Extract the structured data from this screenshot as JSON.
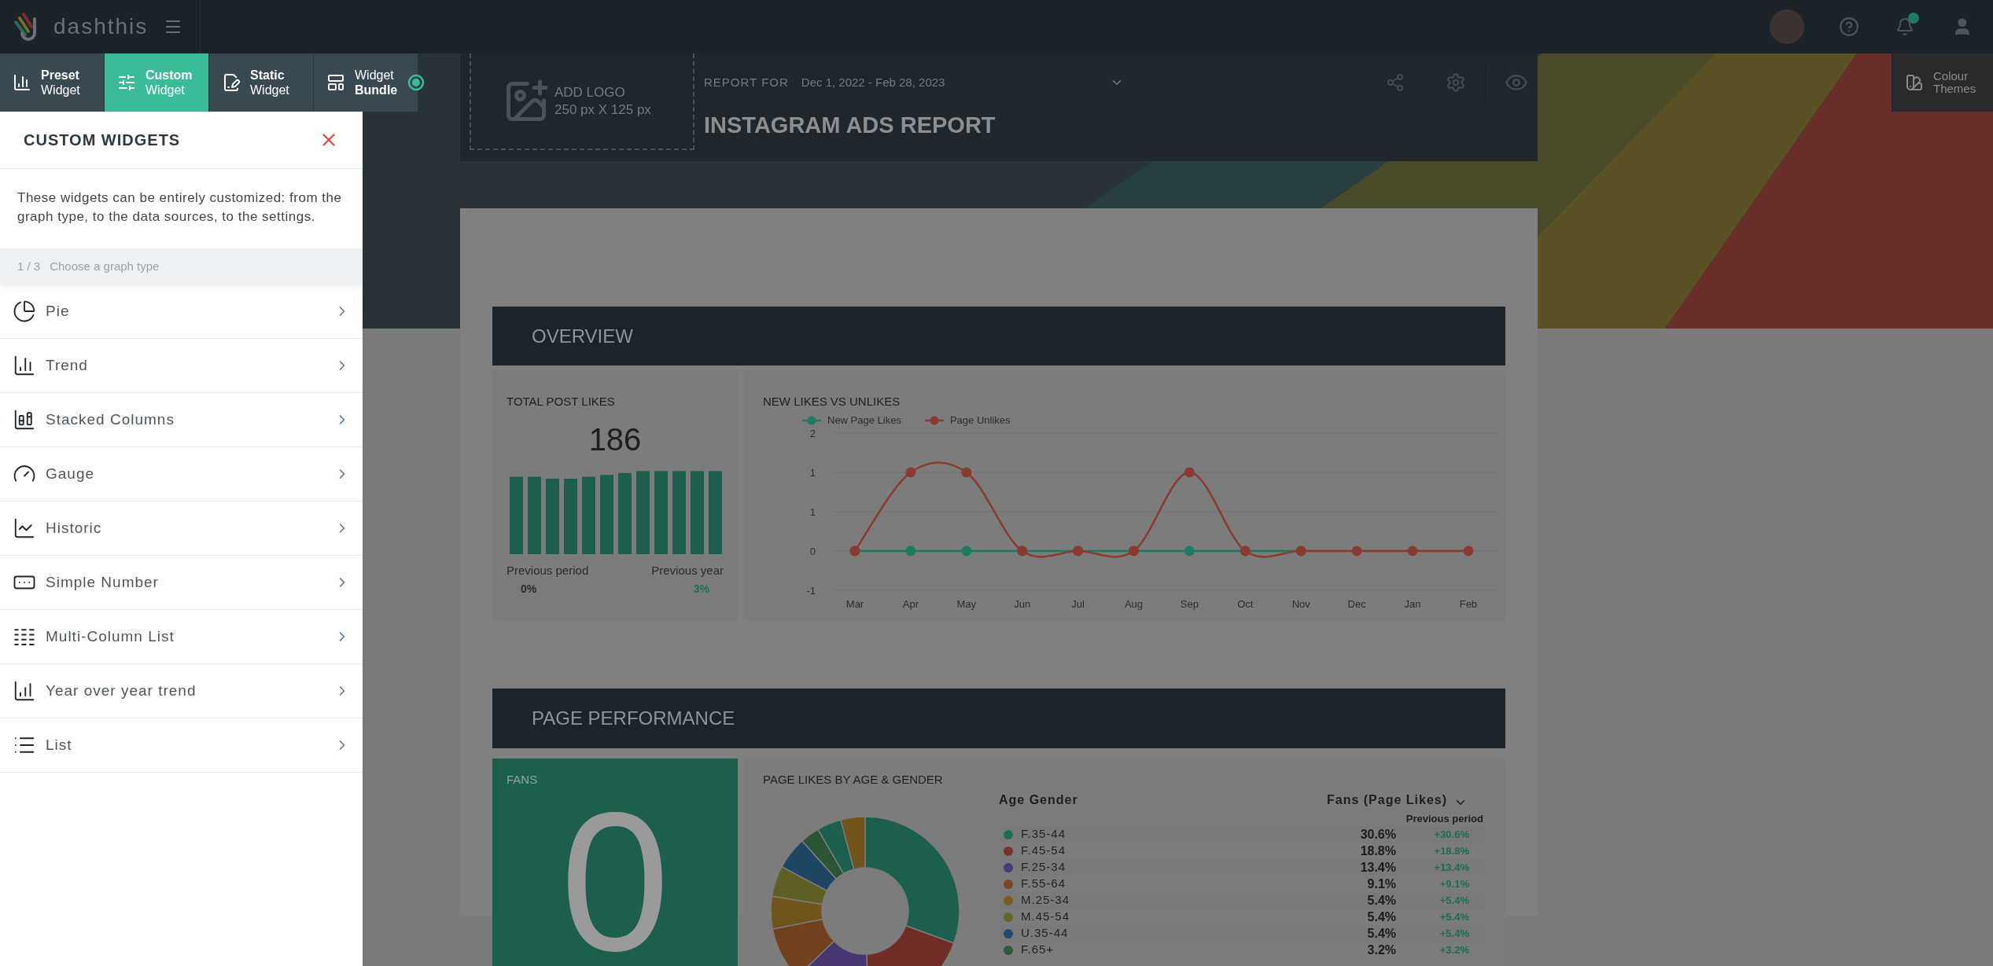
{
  "top_bar": {
    "logo_text": "dashthis",
    "notifications": {
      "unread": true
    }
  },
  "toolbar": {
    "tabs": [
      {
        "label": "**Preset** Widget",
        "kind": "preset",
        "selected": false
      },
      {
        "label": "**Custom** Widget",
        "kind": "custom",
        "selected": true
      },
      {
        "label": "**Static** Widget",
        "kind": "static",
        "selected": false
      },
      {
        "label": "Widget **Bundle**",
        "kind": "bundle",
        "selected": false
      }
    ],
    "colour_themes": "Colour Themes"
  },
  "sidebar": {
    "title": "CUSTOM WIDGETS",
    "description": "These widgets can be entirely customized: from the graph type, to the data sources, to the settings.",
    "step": "1 / 3",
    "step_label": "Choose a graph type",
    "items": [
      {
        "label": "Pie",
        "kind": "pie"
      },
      {
        "label": "Trend",
        "kind": "trend"
      },
      {
        "label": "Stacked Columns",
        "kind": "stacked"
      },
      {
        "label": "Gauge",
        "kind": "gauge"
      },
      {
        "label": "Historic",
        "kind": "historic"
      },
      {
        "label": "Simple Number",
        "kind": "number"
      },
      {
        "label": "Multi-Column List",
        "kind": "multicolumn"
      },
      {
        "label": "Year over year trend",
        "kind": "yoy"
      },
      {
        "label": "List",
        "kind": "list"
      }
    ]
  },
  "report": {
    "logo_placeholder": "ADD LOGO",
    "logo_size": "250 px X 125 px",
    "report_for_label": "REPORT FOR",
    "date_range": "Dec 1, 2022 - Feb 28, 2023",
    "title": "INSTAGRAM ADS REPORT"
  },
  "overview": {
    "title": "OVERVIEW",
    "total_post_likes": {
      "title": "TOTAL POST LIKES",
      "value": "186",
      "previous_period_label": "Previous period",
      "previous_period": "0%",
      "previous_year_label": "Previous year",
      "previous_year": "3%"
    },
    "likes_chart": {
      "title": "NEW LIKES VS UNLIKES",
      "chart_data": {
        "type": "line",
        "categories": [
          "Mar",
          "Apr",
          "May",
          "Jun",
          "Jul",
          "Aug",
          "Sep",
          "Oct",
          "Nov",
          "Dec",
          "Jan",
          "Feb"
        ],
        "ylim": [
          -0.5,
          1.5
        ],
        "yticks": [
          {
            "value": 1.5,
            "label": "2"
          },
          {
            "value": 1,
            "label": "1"
          },
          {
            "value": 0.5,
            "label": "1"
          },
          {
            "value": 0,
            "label": "0"
          },
          {
            "value": -0.5,
            "label": "-1"
          }
        ],
        "series": [
          {
            "name": "New Page Likes",
            "color": "#1e7a62",
            "marker": "circle",
            "values": [
              0,
              0,
              0,
              0,
              0,
              0,
              0,
              0,
              0,
              null,
              null,
              null
            ]
          },
          {
            "name": "Page Unlikes",
            "color": "#8a3a30",
            "marker": "circle",
            "values": [
              0,
              1,
              1,
              0,
              0,
              0,
              1,
              0,
              0,
              0,
              0,
              0
            ]
          }
        ]
      }
    }
  },
  "page_performance": {
    "title": "PAGE PERFORMANCE",
    "fans": {
      "title": "FANS",
      "value": "0"
    },
    "likes_by_age": {
      "title": "PAGE LIKES BY AGE & GENDER",
      "column_1": "Age Gender",
      "column_2": "Fans (Page Likes)",
      "column_3": "Previous period",
      "rows": [
        {
          "label": "F.35-44",
          "value": "30.6%",
          "previous": "+30.6%",
          "color": "#1e6b58"
        },
        {
          "label": "F.45-54",
          "value": "18.8%",
          "previous": "+18.8%",
          "color": "#7a2f2a"
        },
        {
          "label": "F.25-34",
          "value": "13.4%",
          "previous": "+13.4%",
          "color": "#4a3a78"
        },
        {
          "label": "F.55-64",
          "value": "9.1%",
          "previous": "+9.1%",
          "color": "#7a4626"
        },
        {
          "label": "M.25-34",
          "value": "5.4%",
          "previous": "+5.4%",
          "color": "#7a5a22"
        },
        {
          "label": "M.45-54",
          "value": "5.4%",
          "previous": "+5.4%",
          "color": "#66662a"
        },
        {
          "label": "U.35-44",
          "value": "5.4%",
          "previous": "+5.4%",
          "color": "#204c6c"
        },
        {
          "label": "F.65+",
          "value": "3.2%",
          "previous": "+3.2%",
          "color": "#2e5a3a"
        }
      ]
    }
  }
}
